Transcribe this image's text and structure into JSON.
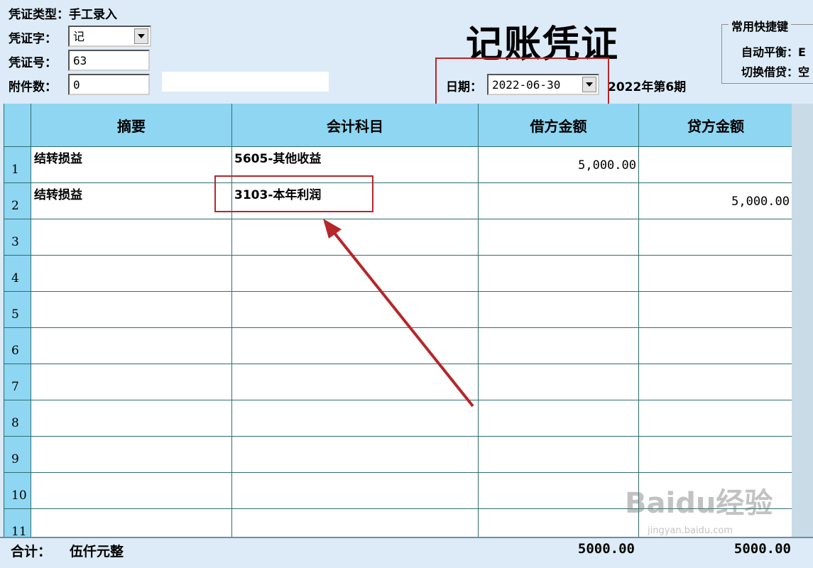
{
  "voucher_type": {
    "label": "凭证类型：",
    "value": "手工录入"
  },
  "voucher_word": {
    "label": "凭证字：",
    "value": "记"
  },
  "voucher_no": {
    "label": "凭证号：",
    "value": "63"
  },
  "attachments": {
    "label": "附件数：",
    "value": "0"
  },
  "title": "记账凭证",
  "date": {
    "label": "日期：",
    "value": "2022-06-30",
    "period": "2022年第6期"
  },
  "shortcuts": {
    "title": "常用快捷键",
    "items": [
      "自动平衡：E",
      "切换借贷：空"
    ]
  },
  "columns": [
    "摘要",
    "会计科目",
    "借方金额",
    "贷方金额"
  ],
  "rows": [
    {
      "num": "1",
      "summary": "结转损益",
      "account": "5605-其他收益",
      "debit": "5,000.00",
      "credit": ""
    },
    {
      "num": "2",
      "summary": "结转损益",
      "account": "3103-本年利润",
      "debit": "",
      "credit": "5,000.00"
    },
    {
      "num": "3",
      "summary": "",
      "account": "",
      "debit": "",
      "credit": ""
    },
    {
      "num": "4",
      "summary": "",
      "account": "",
      "debit": "",
      "credit": ""
    },
    {
      "num": "5",
      "summary": "",
      "account": "",
      "debit": "",
      "credit": ""
    },
    {
      "num": "6",
      "summary": "",
      "account": "",
      "debit": "",
      "credit": ""
    },
    {
      "num": "7",
      "summary": "",
      "account": "",
      "debit": "",
      "credit": ""
    },
    {
      "num": "8",
      "summary": "",
      "account": "",
      "debit": "",
      "credit": ""
    },
    {
      "num": "9",
      "summary": "",
      "account": "",
      "debit": "",
      "credit": ""
    },
    {
      "num": "10",
      "summary": "",
      "account": "",
      "debit": "",
      "credit": ""
    },
    {
      "num": "11",
      "summary": "",
      "account": "",
      "debit": "",
      "credit": ""
    }
  ],
  "footer": {
    "total_label": "合计：",
    "total_words": "伍仟元整",
    "debit_total": "5000.00",
    "credit_total": "5000.00"
  },
  "watermark": {
    "text": "Baidu经验",
    "sub": "jingyan.baidu.com"
  },
  "colors": {
    "header_bg": "#8fd6f2",
    "annotation_red": "#b5272b",
    "page_bg": "#dcebf7"
  }
}
